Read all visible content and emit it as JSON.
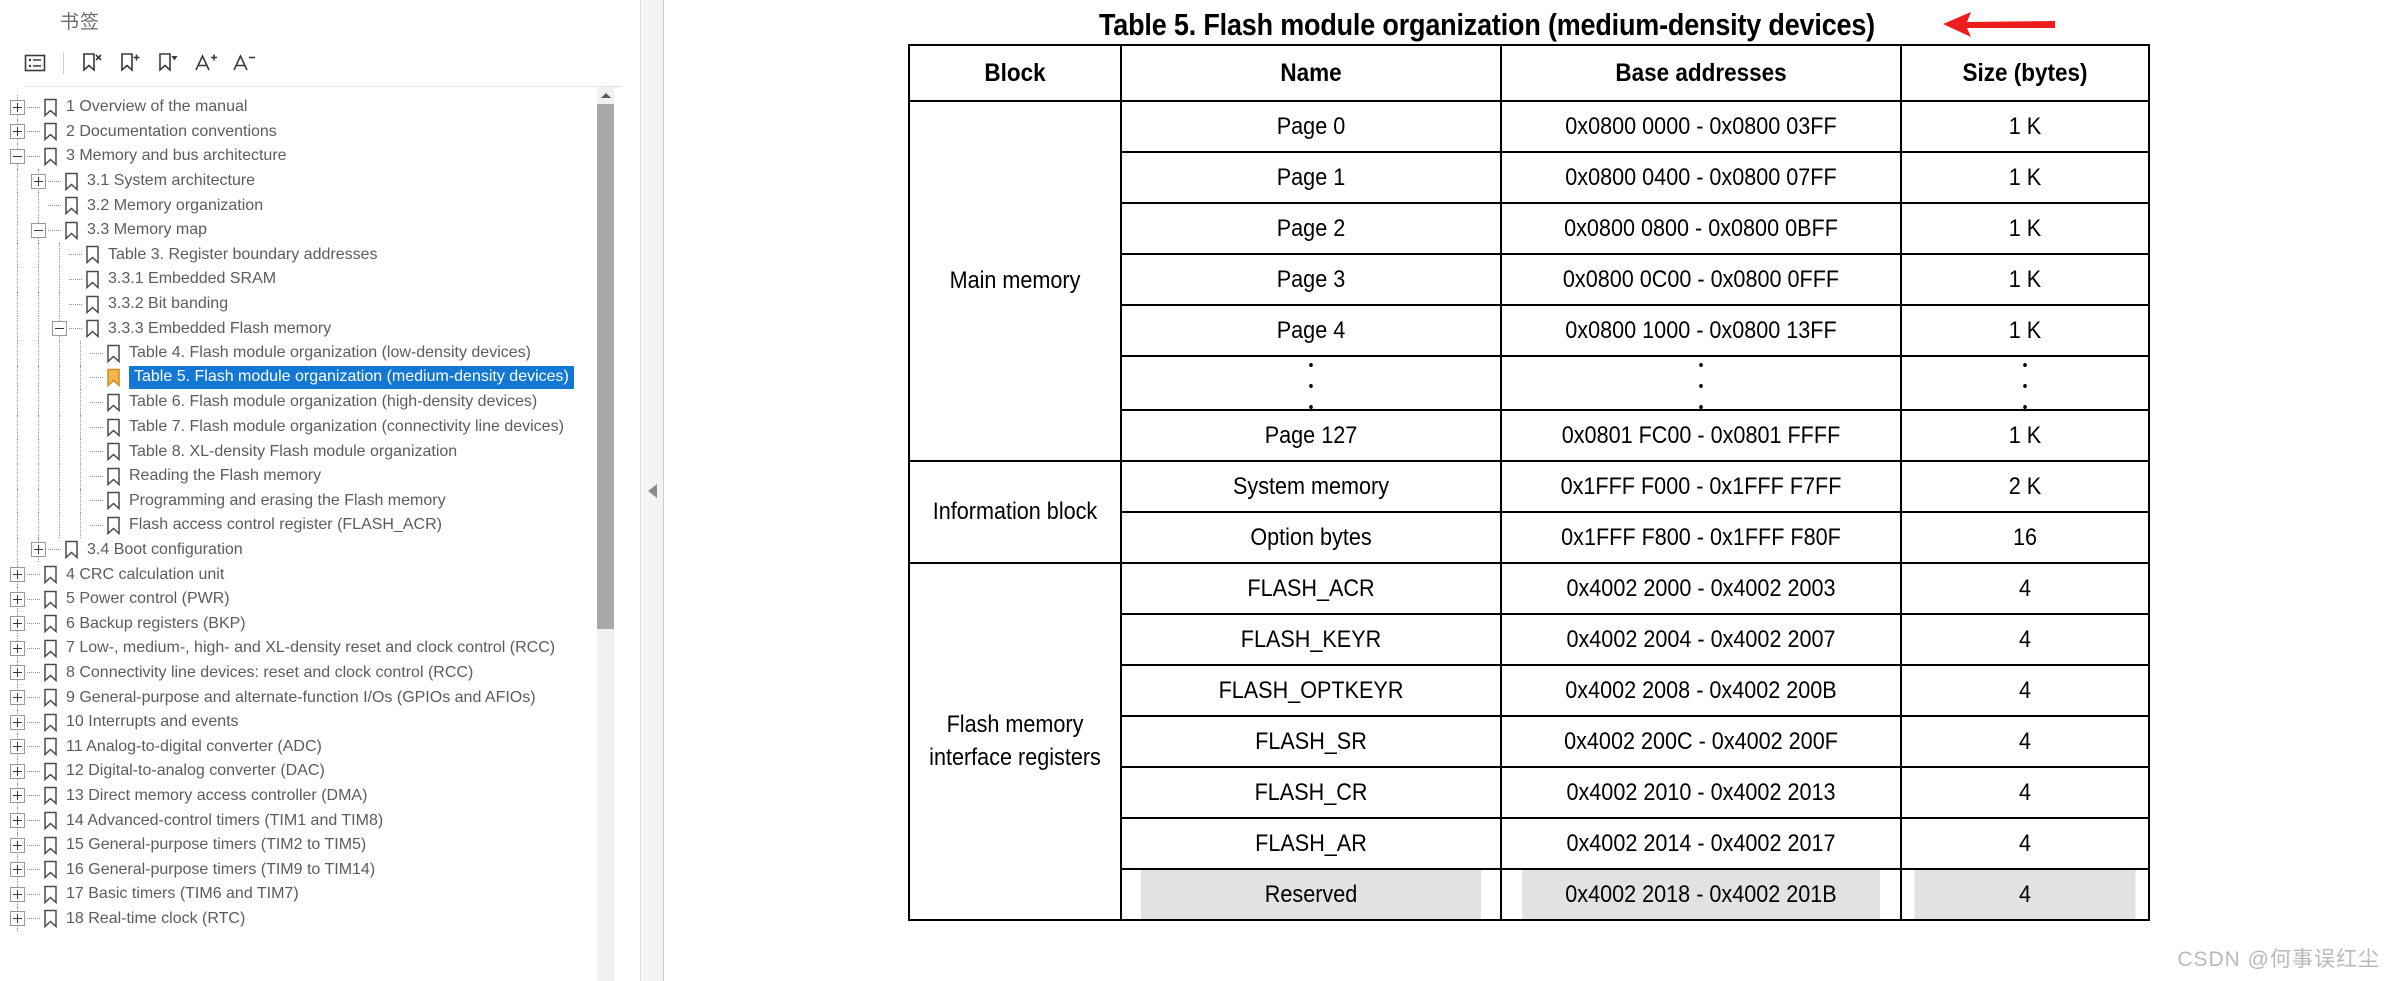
{
  "panel": {
    "tab_label": "书签",
    "toolbar": [
      {
        "name": "expand-list-icon",
        "glyph": "list"
      },
      {
        "name": "delete-bookmark-icon",
        "glyph": "bookmark-x"
      },
      {
        "name": "add-bookmark-icon",
        "glyph": "bookmark-plus"
      },
      {
        "name": "goto-bookmark-icon",
        "glyph": "bookmark-down"
      },
      {
        "name": "increase-font-icon",
        "glyph": "A+"
      },
      {
        "name": "decrease-font-icon",
        "glyph": "A-"
      }
    ]
  },
  "tree": {
    "selected_index": 12,
    "items": [
      {
        "label": "1 Overview of the manual",
        "depth": 0,
        "toggle": "plus"
      },
      {
        "label": "2 Documentation conventions",
        "depth": 0,
        "toggle": "plus"
      },
      {
        "label": "3 Memory and bus architecture",
        "depth": 0,
        "toggle": "minus"
      },
      {
        "label": "3.1 System architecture",
        "depth": 1,
        "toggle": "plus"
      },
      {
        "label": "3.2 Memory organization",
        "depth": 1,
        "toggle": "none"
      },
      {
        "label": "3.3 Memory map",
        "depth": 1,
        "toggle": "minus"
      },
      {
        "label": "Table 3. Register boundary addresses",
        "depth": 2,
        "toggle": "none"
      },
      {
        "label": "3.3.1 Embedded SRAM",
        "depth": 2,
        "toggle": "none"
      },
      {
        "label": "3.3.2 Bit banding",
        "depth": 2,
        "toggle": "none"
      },
      {
        "label": "3.3.3 Embedded Flash memory",
        "depth": 2,
        "toggle": "minus"
      },
      {
        "label": "Table 4. Flash module organization (low-density devices)",
        "depth": 3,
        "toggle": "none"
      },
      {
        "label": "Table 5. Flash module organization (medium-density devices)",
        "depth": 3,
        "toggle": "none",
        "selected": true
      },
      {
        "label": "Table 6. Flash module organization (high-density devices)",
        "depth": 3,
        "toggle": "none"
      },
      {
        "label": "Table 7. Flash module organization (connectivity line devices)",
        "depth": 3,
        "toggle": "none"
      },
      {
        "label": "Table 8. XL-density Flash module organization",
        "depth": 3,
        "toggle": "none"
      },
      {
        "label": "Reading the Flash memory",
        "depth": 3,
        "toggle": "none"
      },
      {
        "label": "Programming and erasing the Flash memory",
        "depth": 3,
        "toggle": "none"
      },
      {
        "label": "Flash access control register (FLASH_ACR)",
        "depth": 3,
        "toggle": "none"
      },
      {
        "label": "3.4 Boot configuration",
        "depth": 1,
        "toggle": "plus"
      },
      {
        "label": "4 CRC calculation unit",
        "depth": 0,
        "toggle": "plus"
      },
      {
        "label": "5 Power control (PWR)",
        "depth": 0,
        "toggle": "plus"
      },
      {
        "label": "6 Backup registers (BKP)",
        "depth": 0,
        "toggle": "plus"
      },
      {
        "label": "7 Low-, medium-, high- and XL-density reset and clock control (RCC)",
        "depth": 0,
        "toggle": "plus"
      },
      {
        "label": "8 Connectivity line devices: reset and clock control (RCC)",
        "depth": 0,
        "toggle": "plus"
      },
      {
        "label": "9 General-purpose and alternate-function I/Os (GPIOs and AFIOs)",
        "depth": 0,
        "toggle": "plus"
      },
      {
        "label": "10 Interrupts and events",
        "depth": 0,
        "toggle": "plus"
      },
      {
        "label": "11 Analog-to-digital converter (ADC)",
        "depth": 0,
        "toggle": "plus"
      },
      {
        "label": "12 Digital-to-analog converter (DAC)",
        "depth": 0,
        "toggle": "plus"
      },
      {
        "label": "13 Direct memory access controller (DMA)",
        "depth": 0,
        "toggle": "plus"
      },
      {
        "label": "14 Advanced-control timers (TIM1 and TIM8)",
        "depth": 0,
        "toggle": "plus"
      },
      {
        "label": "15 General-purpose timers (TIM2 to TIM5)",
        "depth": 0,
        "toggle": "plus"
      },
      {
        "label": "16 General-purpose timers (TIM9 to TIM14)",
        "depth": 0,
        "toggle": "plus"
      },
      {
        "label": "17 Basic timers (TIM6 and TIM7)",
        "depth": 0,
        "toggle": "plus"
      },
      {
        "label": "18 Real-time clock (RTC)",
        "depth": 0,
        "toggle": "plus"
      }
    ]
  },
  "document": {
    "title": "Table 5. Flash module organization (medium-density devices)",
    "annotation": {
      "name": "red-arrow",
      "color": "#ee1c1c"
    },
    "watermark": "CSDN @何事误红尘",
    "table": {
      "headers": [
        "Block",
        "Name",
        "Base addresses",
        "Size (bytes)"
      ],
      "groups": [
        {
          "block": "Main memory",
          "rows": [
            {
              "name": "Page 0",
              "addr": "0x0800 0000 - 0x0800 03FF",
              "size": "1 K"
            },
            {
              "name": "Page 1",
              "addr": "0x0800 0400 - 0x0800 07FF",
              "size": "1 K"
            },
            {
              "name": "Page 2",
              "addr": "0x0800 0800 - 0x0800 0BFF",
              "size": "1 K"
            },
            {
              "name": "Page 3",
              "addr": "0x0800 0C00 - 0x0800 0FFF",
              "size": "1 K"
            },
            {
              "name": "Page 4",
              "addr": "0x0800 1000 - 0x0800 13FF",
              "size": "1 K"
            },
            {
              "name": ".\n.\n.",
              "addr": ".\n.\n.",
              "size": ".\n.\n.",
              "ellipsis": true
            },
            {
              "name": "Page 127",
              "addr": "0x0801 FC00 - 0x0801 FFFF",
              "size": "1 K"
            }
          ]
        },
        {
          "block": "Information block",
          "rows": [
            {
              "name": "System memory",
              "addr": "0x1FFF F000 - 0x1FFF F7FF",
              "size": "2 K"
            },
            {
              "name": "Option bytes",
              "addr": "0x1FFF F800 - 0x1FFF F80F",
              "size": "16"
            }
          ]
        },
        {
          "block": "Flash memory interface registers",
          "rows": [
            {
              "name": "FLASH_ACR",
              "addr": "0x4002 2000 - 0x4002 2003",
              "size": "4"
            },
            {
              "name": "FLASH_KEYR",
              "addr": "0x4002 2004 - 0x4002 2007",
              "size": "4"
            },
            {
              "name": "FLASH_OPTKEYR",
              "addr": "0x4002 2008 - 0x4002 200B",
              "size": "4"
            },
            {
              "name": "FLASH_SR",
              "addr": "0x4002 200C - 0x4002 200F",
              "size": "4"
            },
            {
              "name": "FLASH_CR",
              "addr": "0x4002 2010 - 0x4002 2013",
              "size": "4"
            },
            {
              "name": "FLASH_AR",
              "addr": "0x4002 2014 - 0x4002 2017",
              "size": "4"
            },
            {
              "name": "Reserved",
              "addr": "0x4002 2018 - 0x4002 201B",
              "size": "4",
              "reserved": true
            }
          ]
        }
      ]
    }
  }
}
